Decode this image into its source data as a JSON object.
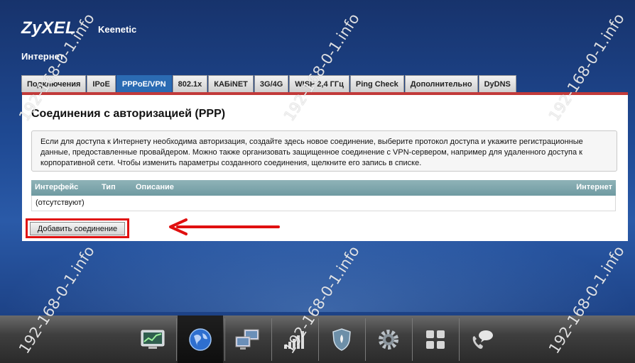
{
  "header": {
    "logo": "ZyXEL",
    "product": "Keenetic",
    "section": "Интернет"
  },
  "tabs": [
    {
      "label": "Подключения"
    },
    {
      "label": "IPoE"
    },
    {
      "label": "PPPoE/VPN",
      "active": true
    },
    {
      "label": "802.1x"
    },
    {
      "label": "КАБiNET"
    },
    {
      "label": "3G/4G"
    },
    {
      "label": "WISP 2,4 ГГц"
    },
    {
      "label": "Ping Check"
    },
    {
      "label": "Дополнительно"
    },
    {
      "label": "DyDNS"
    }
  ],
  "panel": {
    "title": "Соединения с авторизацией (PPP)",
    "info": "Если для доступа к Интернету необходима авторизация, создайте здесь новое соединение, выберите протокол доступа и укажите регистрационные данные, предоставленные провайдером. Можно также организовать защищенное соединение с VPN-сервером, например для удаленного доступа к корпоративной сети. Чтобы изменить параметры созданного соединения, щелкните его запись в списке.",
    "table": {
      "col_interface": "Интерфейс",
      "col_type": "Тип",
      "col_description": "Описание",
      "col_internet": "Интернет",
      "empty": "(отсутствуют)"
    },
    "add_button": "Добавить соединение"
  },
  "watermark": "192-168-0-1.info",
  "dock": {
    "items": [
      {
        "icon": "monitor-chart-icon"
      },
      {
        "icon": "globe-icon",
        "active": true
      },
      {
        "icon": "network-computers-icon"
      },
      {
        "icon": "signal-bars-icon"
      },
      {
        "icon": "shield-icon"
      },
      {
        "icon": "gear-icon"
      },
      {
        "icon": "apps-grid-icon"
      },
      {
        "icon": "phone-chat-icon"
      }
    ]
  },
  "colors": {
    "accent": "#2b6bb3",
    "highlight": "#e01010",
    "panel_top": "#c23a3a"
  }
}
